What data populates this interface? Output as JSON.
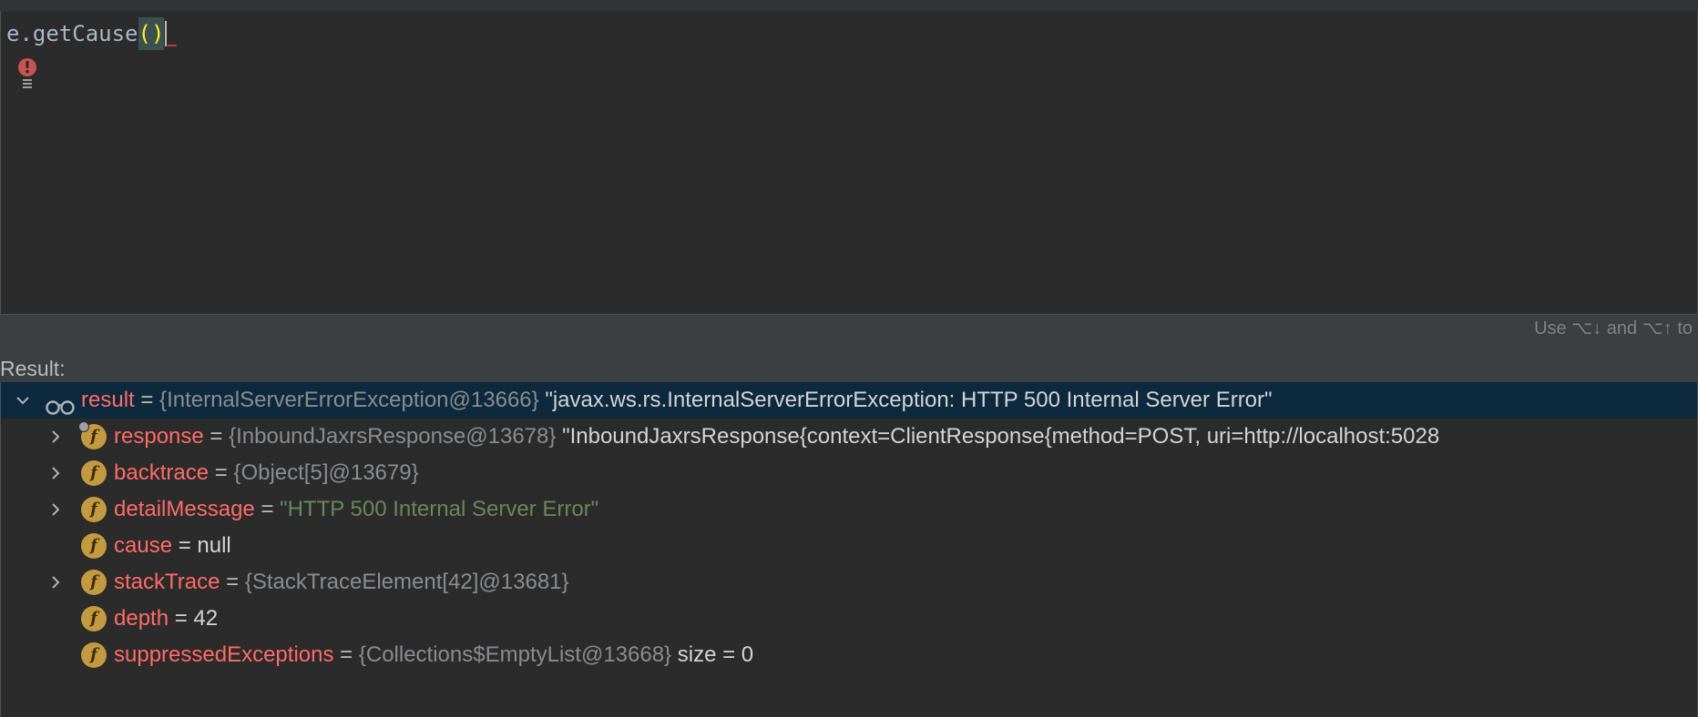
{
  "editor": {
    "expression_prefix": "e.getCause",
    "expression_parens": "()"
  },
  "hint": "Use ⌥↓ and ⌥↑ to",
  "result_label": "Result:",
  "tree": {
    "root": {
      "name": "result",
      "eq": "=",
      "type": "{InternalServerErrorException@13666}",
      "value": "\"javax.ws.rs.InternalServerErrorException: HTTP 500 Internal Server Error\""
    },
    "children": [
      {
        "name": "response",
        "eq": "=",
        "type": "{InboundJaxrsResponse@13678}",
        "value": "\"InboundJaxrsResponse{context=ClientResponse{method=POST, uri=http://localhost:5028",
        "value_kind": "plain",
        "expandable": true
      },
      {
        "name": "backtrace",
        "eq": "=",
        "type": "{Object[5]@13679}",
        "value": "",
        "value_kind": "plain",
        "expandable": true
      },
      {
        "name": "detailMessage",
        "eq": "=",
        "type": "",
        "value": "\"HTTP 500 Internal Server Error\"",
        "value_kind": "string",
        "expandable": true
      },
      {
        "name": "cause",
        "eq": "= null",
        "type": "",
        "value": "",
        "value_kind": "plain",
        "expandable": false
      },
      {
        "name": "stackTrace",
        "eq": "=",
        "type": "{StackTraceElement[42]@13681}",
        "value": "",
        "value_kind": "plain",
        "expandable": true
      },
      {
        "name": "depth",
        "eq": "= 42",
        "type": "",
        "value": "",
        "value_kind": "plain",
        "expandable": false
      },
      {
        "name": "suppressedExceptions",
        "eq": "=",
        "type": "{Collections$EmptyList@13668}",
        "value": " size = 0",
        "value_kind": "plain",
        "expandable": false
      }
    ],
    "field_icon_letter": "f"
  },
  "colors": {
    "background": "#2b2b2b",
    "panel": "#3c3f41",
    "selection": "#0d293e",
    "field_name": "#ff6b68",
    "type_gray": "#8a8d90",
    "string_green": "#6a8759",
    "field_icon": "#c39a3f",
    "error_red": "#c75450",
    "paren_highlight": "#ffef28"
  },
  "icons": {
    "error": "error-badge-icon",
    "watch": "watch-glasses-icon",
    "expand": "chevron-right-icon",
    "collapse": "chevron-down-icon",
    "field": "field-f-icon"
  }
}
